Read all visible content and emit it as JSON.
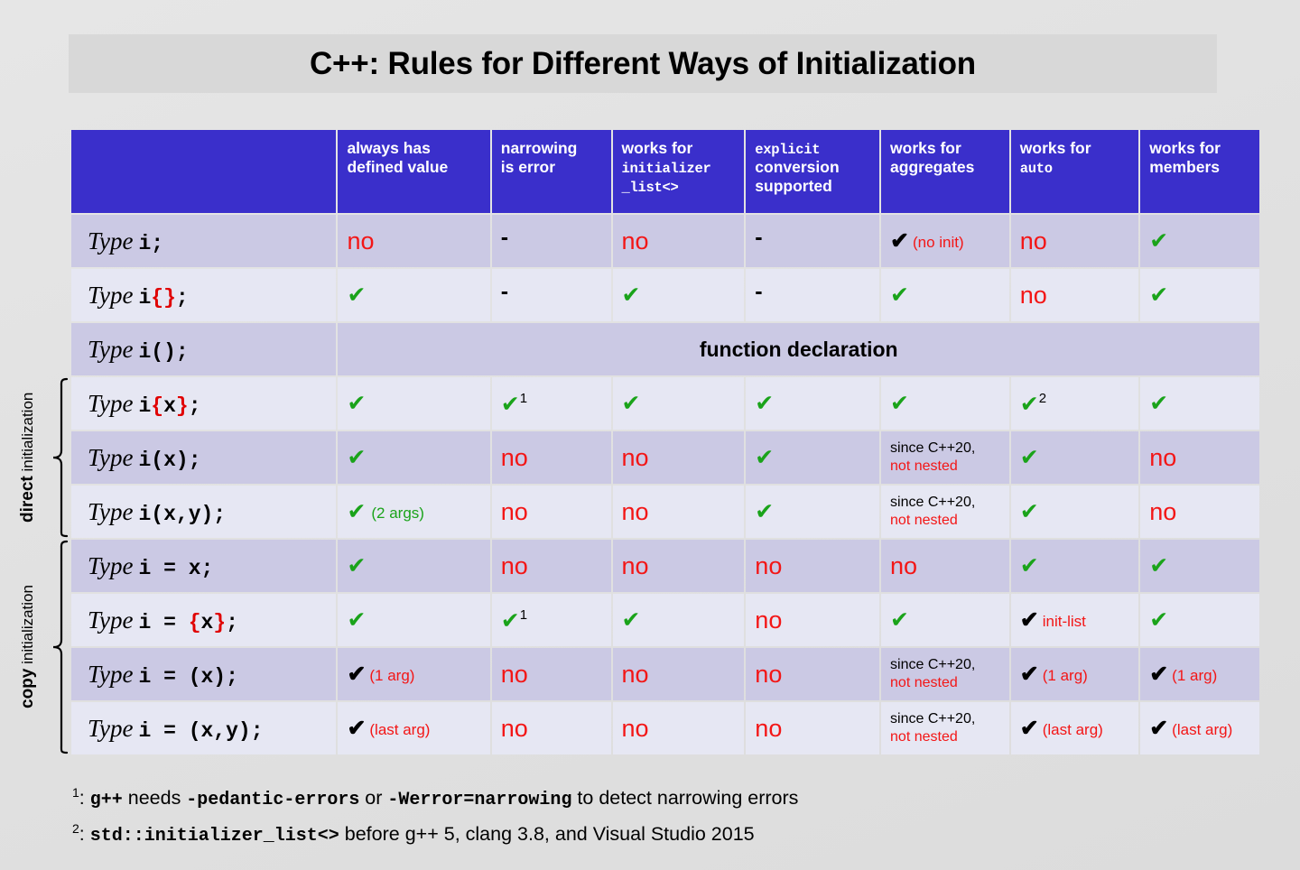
{
  "title": "C++: Rules for Different Ways of Initialization",
  "colors": {
    "header_bg": "#3a2fcb",
    "row_dark": "#cbc9e4",
    "row_light": "#e6e7f3",
    "page_bg": "#e2e2e2",
    "title_bg": "#d8d8d8",
    "yes_green": "#1aa31a",
    "no_red": "#f31616",
    "black": "#000000"
  },
  "columns": [
    {
      "id": "expr",
      "label": "",
      "mono_part": ""
    },
    {
      "id": "defined_value",
      "line1": "always has",
      "line2": "defined value",
      "line2_mono": false
    },
    {
      "id": "narrowing",
      "line1": "narrowing",
      "line2": "is error",
      "line2_mono": false
    },
    {
      "id": "init_list",
      "line1": "works for",
      "line2": "initializer",
      "line3": "_list<>",
      "line2_mono": true
    },
    {
      "id": "explicit_conv",
      "line1": "explicit",
      "line1_mono": true,
      "line2": "conversion",
      "line3": "supported"
    },
    {
      "id": "aggregates",
      "line1": "works for",
      "line2": "aggregates",
      "line2_mono": false
    },
    {
      "id": "auto",
      "line1": "works for",
      "line2": "auto",
      "line2_mono": true
    },
    {
      "id": "members",
      "line1": "works for",
      "line2": "members",
      "line2_mono": false
    }
  ],
  "side_groups": [
    {
      "id": "direct",
      "bold": "direct",
      "rest": " initialization",
      "rows": [
        3,
        4,
        5
      ]
    },
    {
      "id": "copy",
      "bold": "copy",
      "rest": " initialization",
      "rows": [
        6,
        7,
        8,
        9
      ]
    }
  ],
  "rows": [
    {
      "expr_parts": [
        {
          "t": "Type",
          "k": "type"
        },
        {
          "t": "i;",
          "k": "code"
        }
      ],
      "shade": "dark",
      "cells": [
        {
          "kind": "no",
          "text": "no"
        },
        {
          "kind": "dash",
          "text": "-"
        },
        {
          "kind": "no",
          "text": "no"
        },
        {
          "kind": "dash",
          "text": "-"
        },
        {
          "kind": "check-black",
          "note": "(no init)",
          "note_color": "red"
        },
        {
          "kind": "no",
          "text": "no"
        },
        {
          "kind": "check-green"
        }
      ]
    },
    {
      "expr_parts": [
        {
          "t": "Type",
          "k": "type"
        },
        {
          "t": "i",
          "k": "code"
        },
        {
          "t": "{}",
          "k": "brace"
        },
        {
          "t": ";",
          "k": "code"
        }
      ],
      "shade": "light",
      "cells": [
        {
          "kind": "check-green"
        },
        {
          "kind": "dash",
          "text": "-"
        },
        {
          "kind": "check-green"
        },
        {
          "kind": "dash",
          "text": "-"
        },
        {
          "kind": "check-green"
        },
        {
          "kind": "no",
          "text": "no"
        },
        {
          "kind": "check-green"
        }
      ]
    },
    {
      "expr_parts": [
        {
          "t": "Type",
          "k": "type"
        },
        {
          "t": "i();",
          "k": "code"
        }
      ],
      "shade": "dark",
      "span_all": true,
      "span_text": "function declaration",
      "cells": []
    },
    {
      "expr_parts": [
        {
          "t": "Type",
          "k": "type"
        },
        {
          "t": "i",
          "k": "code"
        },
        {
          "t": "{",
          "k": "brace"
        },
        {
          "t": "x",
          "k": "code"
        },
        {
          "t": "}",
          "k": "brace"
        },
        {
          "t": ";",
          "k": "code"
        }
      ],
      "shade": "light",
      "cells": [
        {
          "kind": "check-green"
        },
        {
          "kind": "check-green",
          "sup": "1"
        },
        {
          "kind": "check-green"
        },
        {
          "kind": "check-green"
        },
        {
          "kind": "check-green"
        },
        {
          "kind": "check-green",
          "sup": "2"
        },
        {
          "kind": "check-green"
        }
      ]
    },
    {
      "expr_parts": [
        {
          "t": "Type",
          "k": "type"
        },
        {
          "t": "i(x);",
          "k": "code"
        }
      ],
      "shade": "dark",
      "cells": [
        {
          "kind": "check-green"
        },
        {
          "kind": "no",
          "text": "no"
        },
        {
          "kind": "no",
          "text": "no"
        },
        {
          "kind": "check-green"
        },
        {
          "kind": "twoline",
          "line1": "since C++20,",
          "line2": "not nested"
        },
        {
          "kind": "check-green"
        },
        {
          "kind": "no",
          "text": "no"
        }
      ]
    },
    {
      "expr_parts": [
        {
          "t": "Type",
          "k": "type"
        },
        {
          "t": "i(x,y);",
          "k": "code"
        }
      ],
      "shade": "light",
      "cells": [
        {
          "kind": "check-green",
          "note": "(2 args)",
          "note_color": "green"
        },
        {
          "kind": "no",
          "text": "no"
        },
        {
          "kind": "no",
          "text": "no"
        },
        {
          "kind": "check-green"
        },
        {
          "kind": "twoline",
          "line1": "since C++20,",
          "line2": "not nested"
        },
        {
          "kind": "check-green"
        },
        {
          "kind": "no",
          "text": "no"
        }
      ]
    },
    {
      "expr_parts": [
        {
          "t": "Type",
          "k": "type"
        },
        {
          "t": "i = x;",
          "k": "code"
        }
      ],
      "shade": "dark",
      "cells": [
        {
          "kind": "check-green"
        },
        {
          "kind": "no",
          "text": "no"
        },
        {
          "kind": "no",
          "text": "no"
        },
        {
          "kind": "no",
          "text": "no"
        },
        {
          "kind": "no",
          "text": "no"
        },
        {
          "kind": "check-green"
        },
        {
          "kind": "check-green"
        }
      ]
    },
    {
      "expr_parts": [
        {
          "t": "Type",
          "k": "type"
        },
        {
          "t": "i = ",
          "k": "code"
        },
        {
          "t": "{",
          "k": "brace"
        },
        {
          "t": "x",
          "k": "code"
        },
        {
          "t": "}",
          "k": "brace"
        },
        {
          "t": ";",
          "k": "code"
        }
      ],
      "shade": "light",
      "cells": [
        {
          "kind": "check-green"
        },
        {
          "kind": "check-green",
          "sup": "1"
        },
        {
          "kind": "check-green"
        },
        {
          "kind": "no",
          "text": "no"
        },
        {
          "kind": "check-green"
        },
        {
          "kind": "check-black",
          "note": "init-list",
          "note_color": "red"
        },
        {
          "kind": "check-green"
        }
      ]
    },
    {
      "expr_parts": [
        {
          "t": "Type",
          "k": "type"
        },
        {
          "t": "i = (x);",
          "k": "code"
        }
      ],
      "shade": "dark",
      "cells": [
        {
          "kind": "check-black",
          "note": "(1 arg)",
          "note_color": "red"
        },
        {
          "kind": "no",
          "text": "no"
        },
        {
          "kind": "no",
          "text": "no"
        },
        {
          "kind": "no",
          "text": "no"
        },
        {
          "kind": "twoline",
          "line1": "since C++20,",
          "line2": "not nested"
        },
        {
          "kind": "check-black",
          "note": "(1 arg)",
          "note_color": "red"
        },
        {
          "kind": "check-black",
          "note": "(1 arg)",
          "note_color": "red"
        }
      ]
    },
    {
      "expr_parts": [
        {
          "t": "Type",
          "k": "type"
        },
        {
          "t": "i = (x,y);",
          "k": "code"
        }
      ],
      "shade": "light",
      "cells": [
        {
          "kind": "check-black",
          "note": "(last arg)",
          "note_color": "red"
        },
        {
          "kind": "no",
          "text": "no"
        },
        {
          "kind": "no",
          "text": "no"
        },
        {
          "kind": "no",
          "text": "no"
        },
        {
          "kind": "twoline",
          "line1": "since C++20,",
          "line2": "not nested"
        },
        {
          "kind": "check-black",
          "note": "(last arg)",
          "note_color": "red"
        },
        {
          "kind": "check-black",
          "note": "(last arg)",
          "note_color": "red"
        }
      ]
    }
  ],
  "footnotes": [
    {
      "marker": "1",
      "parts": [
        {
          "t": ": ",
          "m": false
        },
        {
          "t": "g++",
          "m": true
        },
        {
          "t": " needs ",
          "m": false
        },
        {
          "t": "-pedantic-errors",
          "m": true
        },
        {
          "t": " or ",
          "m": false
        },
        {
          "t": "-Werror=narrowing",
          "m": true
        },
        {
          "t": " to detect narrowing errors",
          "m": false
        }
      ]
    },
    {
      "marker": "2",
      "parts": [
        {
          "t": ": ",
          "m": false
        },
        {
          "t": "std::initializer_list<>",
          "m": true
        },
        {
          "t": " before g++ 5, clang 3.8, and Visual Studio 2015",
          "m": false
        }
      ]
    }
  ]
}
